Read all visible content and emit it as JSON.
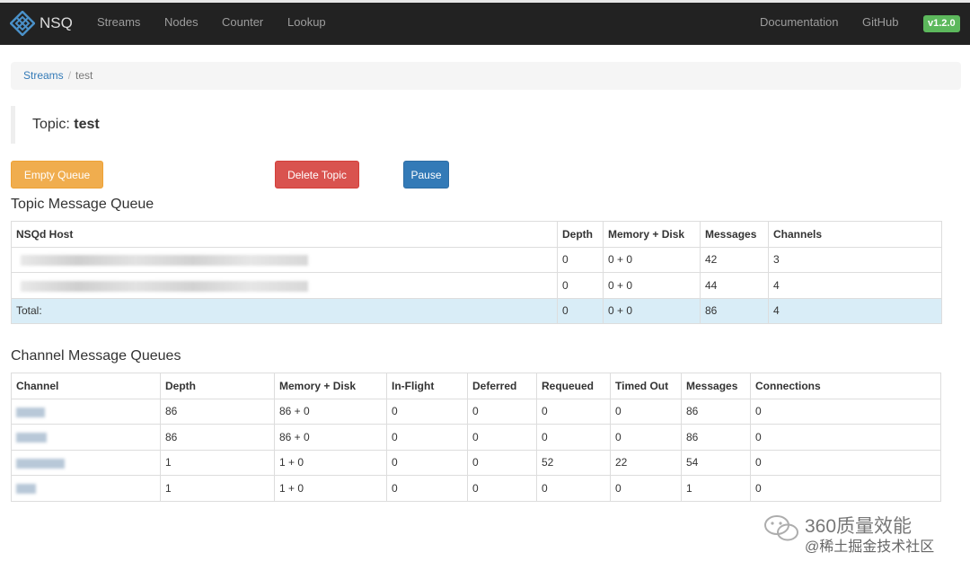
{
  "navbar": {
    "brand": "NSQ",
    "links": [
      "Streams",
      "Nodes",
      "Counter",
      "Lookup"
    ],
    "right_links": [
      "Documentation",
      "GitHub"
    ],
    "version": "v1.2.0"
  },
  "breadcrumb": {
    "parent": "Streams",
    "separator": "/",
    "current": "test"
  },
  "topic": {
    "prefix": "Topic:",
    "name": "test"
  },
  "buttons": {
    "empty_queue": "Empty Queue",
    "delete_topic": "Delete Topic",
    "pause": "Pause"
  },
  "topic_queue": {
    "title": "Topic Message Queue",
    "headers": [
      "NSQd Host",
      "Depth",
      "Memory + Disk",
      "Messages",
      "Channels"
    ],
    "rows": [
      {
        "depth": "0",
        "mem_disk": "0 + 0",
        "messages": "42",
        "channels": "3"
      },
      {
        "depth": "0",
        "mem_disk": "0 + 0",
        "messages": "44",
        "channels": "4"
      }
    ],
    "total": {
      "label": "Total:",
      "depth": "0",
      "mem_disk": "0 + 0",
      "messages": "86",
      "channels": "4"
    }
  },
  "channel_queues": {
    "title": "Channel Message Queues",
    "headers": [
      "Channel",
      "Depth",
      "Memory + Disk",
      "In-Flight",
      "Deferred",
      "Requeued",
      "Timed Out",
      "Messages",
      "Connections"
    ],
    "rows": [
      {
        "depth": "86",
        "mem_disk": "86 + 0",
        "in_flight": "0",
        "deferred": "0",
        "requeued": "0",
        "timed_out": "0",
        "messages": "86",
        "connections": "0"
      },
      {
        "depth": "86",
        "mem_disk": "86 + 0",
        "in_flight": "0",
        "deferred": "0",
        "requeued": "0",
        "timed_out": "0",
        "messages": "86",
        "connections": "0"
      },
      {
        "depth": "1",
        "mem_disk": "1 + 0",
        "in_flight": "0",
        "deferred": "0",
        "requeued": "52",
        "timed_out": "22",
        "messages": "54",
        "connections": "0"
      },
      {
        "depth": "1",
        "mem_disk": "1 + 0",
        "in_flight": "0",
        "deferred": "0",
        "requeued": "0",
        "timed_out": "0",
        "messages": "1",
        "connections": "0"
      }
    ]
  },
  "watermark": {
    "line1": "360质量效能",
    "line2": "@稀土掘金技术社区"
  },
  "colors": {
    "navbar": "#222222",
    "total_row": "#d9edf7",
    "warning": "#f0ad4e",
    "danger": "#d9534f",
    "primary": "#337ab7",
    "version_badge": "#5cb85c"
  }
}
